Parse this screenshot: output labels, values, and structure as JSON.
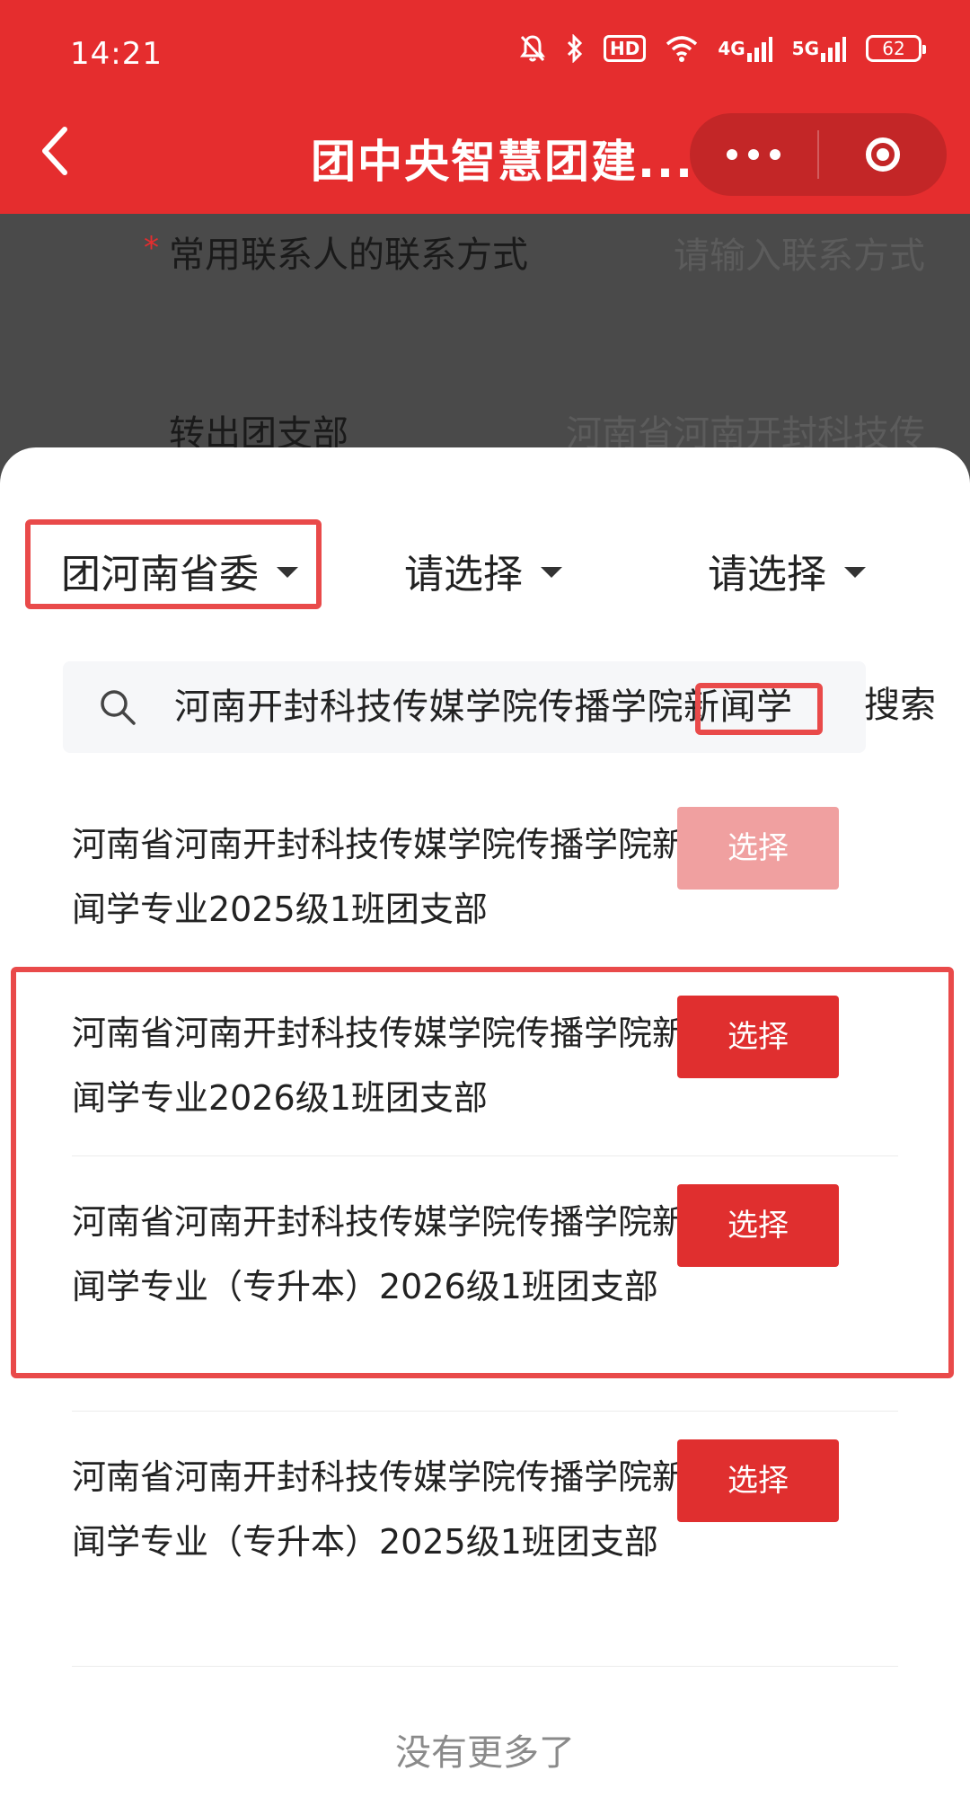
{
  "status_bar": {
    "time": "14:21",
    "hd_label": "HD",
    "net_4g": "4G",
    "net_5g": "5G",
    "battery": "62"
  },
  "nav": {
    "title": "团中央智慧团建..."
  },
  "form": {
    "contact_label": "常用联系人的联系方式",
    "contact_required": "*",
    "contact_placeholder": "请输入联系方式",
    "branch_label": "转出团支部",
    "branch_value": "河南省河南开封科技传"
  },
  "filters": {
    "province": "团河南省委",
    "level2": "请选择",
    "level3": "请选择"
  },
  "search": {
    "value": "河南开封科技传媒学院传播学院新闻学",
    "button_label": "搜索"
  },
  "results": [
    {
      "name": "河南省河南开封科技传媒学院传播学院新闻学专业2025级1班团支部",
      "button": "选择",
      "state": "disabled"
    },
    {
      "name": "河南省河南开封科技传媒学院传播学院新闻学专业2026级1班团支部",
      "button": "选择",
      "state": "enabled"
    },
    {
      "name": "河南省河南开封科技传媒学院传播学院新闻学专业（专升本）2026级1班团支部",
      "button": "选择",
      "state": "enabled"
    },
    {
      "name": "河南省河南开封科技传媒学院传播学院新闻学专业（专升本）2025级1班团支部",
      "button": "选择",
      "state": "enabled"
    }
  ],
  "footer": {
    "no_more": "没有更多了"
  },
  "colors": {
    "brand_red": "#e52d2e",
    "button_red": "#e02f2f",
    "button_disabled": "#f0a0a0",
    "highlight": "#e94a4a"
  }
}
